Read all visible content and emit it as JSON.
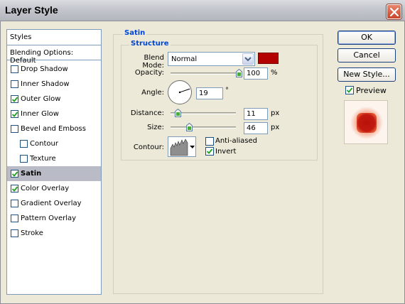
{
  "window": {
    "title": "Layer Style"
  },
  "styles_list": {
    "header": "Styles",
    "blending": "Blending Options: Default",
    "items": [
      {
        "label": "Drop Shadow",
        "checked": false,
        "indent": false,
        "selected": false
      },
      {
        "label": "Inner Shadow",
        "checked": false,
        "indent": false,
        "selected": false
      },
      {
        "label": "Outer Glow",
        "checked": true,
        "indent": false,
        "selected": false
      },
      {
        "label": "Inner Glow",
        "checked": true,
        "indent": false,
        "selected": false
      },
      {
        "label": "Bevel and Emboss",
        "checked": false,
        "indent": false,
        "selected": false
      },
      {
        "label": "Contour",
        "checked": false,
        "indent": true,
        "selected": false
      },
      {
        "label": "Texture",
        "checked": false,
        "indent": true,
        "selected": false
      },
      {
        "label": "Satin",
        "checked": true,
        "indent": false,
        "selected": true
      },
      {
        "label": "Color Overlay",
        "checked": true,
        "indent": false,
        "selected": false
      },
      {
        "label": "Gradient Overlay",
        "checked": false,
        "indent": false,
        "selected": false
      },
      {
        "label": "Pattern Overlay",
        "checked": false,
        "indent": false,
        "selected": false
      },
      {
        "label": "Stroke",
        "checked": false,
        "indent": false,
        "selected": false
      }
    ]
  },
  "satin": {
    "group_title": "Satin",
    "structure_title": "Structure",
    "blend_mode_label": "Blend Mode:",
    "blend_mode_value": "Normal",
    "color": "#b30000",
    "opacity_label": "Opacity:",
    "opacity_value": "100",
    "opacity_fraction": 1.0,
    "angle_label": "Angle:",
    "angle_value": "19",
    "angle_unit": "°",
    "distance_label": "Distance:",
    "distance_value": "11",
    "distance_fraction": 0.05,
    "size_label": "Size:",
    "size_value": "46",
    "size_fraction": 0.23,
    "contour_label": "Contour:",
    "anti_aliased_label": "Anti-aliased",
    "anti_aliased": false,
    "invert_label": "Invert",
    "invert": true,
    "percent": "%",
    "px": "px"
  },
  "buttons": {
    "ok": "OK",
    "cancel": "Cancel",
    "new_style": "New Style..."
  },
  "preview": {
    "label": "Preview",
    "checked": true
  }
}
